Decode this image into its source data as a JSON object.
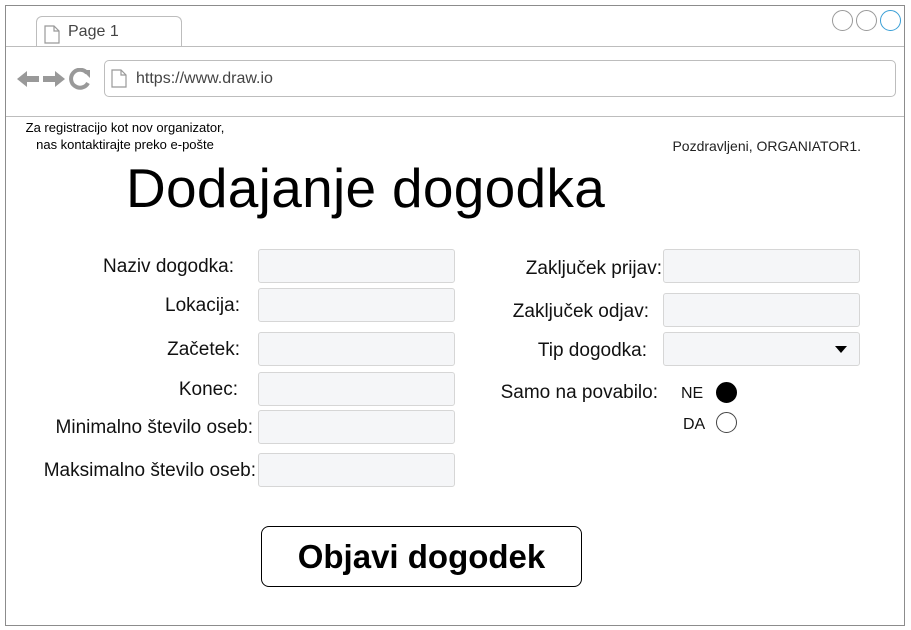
{
  "browser": {
    "tab_label": "Page 1",
    "url": "https://www.draw.io"
  },
  "header": {
    "note_line1": "Za registracijo kot nov organizator,",
    "note_line2": "nas kontaktirajte preko e-pošte",
    "greeting": "Pozdravljeni, ORGANIATOR1."
  },
  "page": {
    "title": "Dodajanje dogodka"
  },
  "form": {
    "left": {
      "naziv": "Naziv dogodka:",
      "lokacija": "Lokacija:",
      "zacetek": "Začetek:",
      "konec": "Konec:",
      "min": "Minimalno število oseb:",
      "max": "Maksimalno število oseb:"
    },
    "right": {
      "zakljucek_prijav": "Zaključek prijav:",
      "zakljucek_odjav": "Zaključek odjav:",
      "tip": "Tip dogodka:",
      "samo_na_povabilo": "Samo na povabilo:"
    },
    "invite_options": [
      {
        "label": "NE",
        "selected": true
      },
      {
        "label": "DA",
        "selected": false
      }
    ],
    "submit_label": "Objavi dogodek"
  }
}
